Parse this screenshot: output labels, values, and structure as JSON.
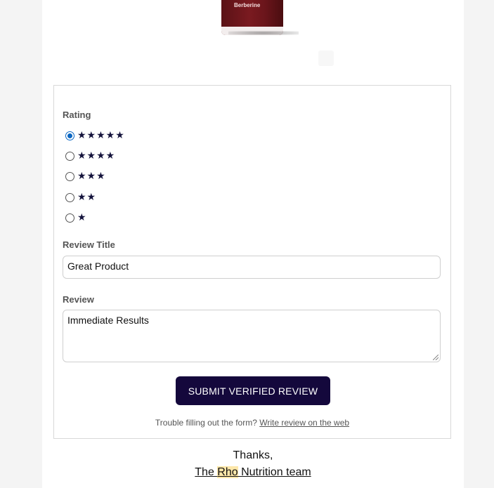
{
  "product": {
    "image_label": "Berberine"
  },
  "form": {
    "rating_label": "Rating",
    "rating_options": [
      {
        "stars": "★★★★★",
        "checked": true
      },
      {
        "stars": "★★★★",
        "checked": false
      },
      {
        "stars": "★★★",
        "checked": false
      },
      {
        "stars": "★★",
        "checked": false
      },
      {
        "stars": "★",
        "checked": false
      }
    ],
    "review_title_label": "Review Title",
    "review_title_value": "Great Product",
    "review_label": "Review",
    "review_value": "Immediate Results",
    "submit_label": "SUBMIT VERIFIED REVIEW",
    "trouble_text": "Trouble filling out the form?",
    "trouble_link": "Write review on the web"
  },
  "footer": {
    "thanks": "Thanks,",
    "team_prefix": "The ",
    "team_highlight": "Rho",
    "team_suffix": " Nutrition team"
  },
  "colors": {
    "accent": "#14083c",
    "radio_selected": "#0a66c2",
    "highlight": "#fde7a9"
  }
}
